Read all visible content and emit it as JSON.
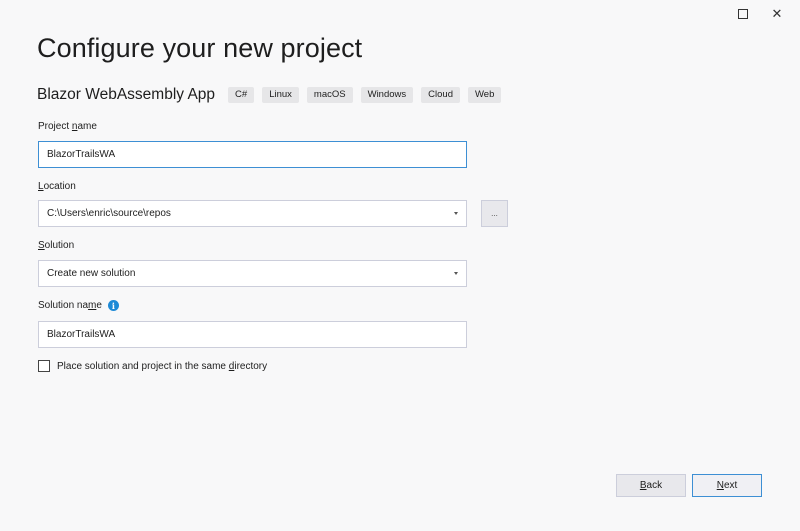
{
  "window": {
    "maximize_icon": "maximize-icon",
    "close_glyph": "✕"
  },
  "page_title": "Configure your new project",
  "template": {
    "name": "Blazor WebAssembly App",
    "tags": [
      "C#",
      "Linux",
      "macOS",
      "Windows",
      "Cloud",
      "Web"
    ]
  },
  "fields": {
    "project_name": {
      "label_pre": "Project ",
      "label_key": "n",
      "label_post": "ame",
      "value": "BlazorTrailsWA"
    },
    "location": {
      "label_pre": "",
      "label_key": "L",
      "label_post": "ocation",
      "value": "C:\\Users\\enric\\source\\repos",
      "browse_label": "..."
    },
    "solution": {
      "label_pre": "",
      "label_key": "S",
      "label_post": "olution",
      "value": "Create new solution"
    },
    "solution_name": {
      "label_pre": "Solution na",
      "label_key": "m",
      "label_post": "e",
      "value": "BlazorTrailsWA",
      "info_glyph": "i"
    }
  },
  "same_directory": {
    "label_pre": "Place solution and project in the same ",
    "label_key": "d",
    "label_post": "irectory",
    "checked": false
  },
  "buttons": {
    "back": {
      "key": "B",
      "rest": "ack"
    },
    "next": {
      "key": "N",
      "rest": "ext"
    }
  }
}
